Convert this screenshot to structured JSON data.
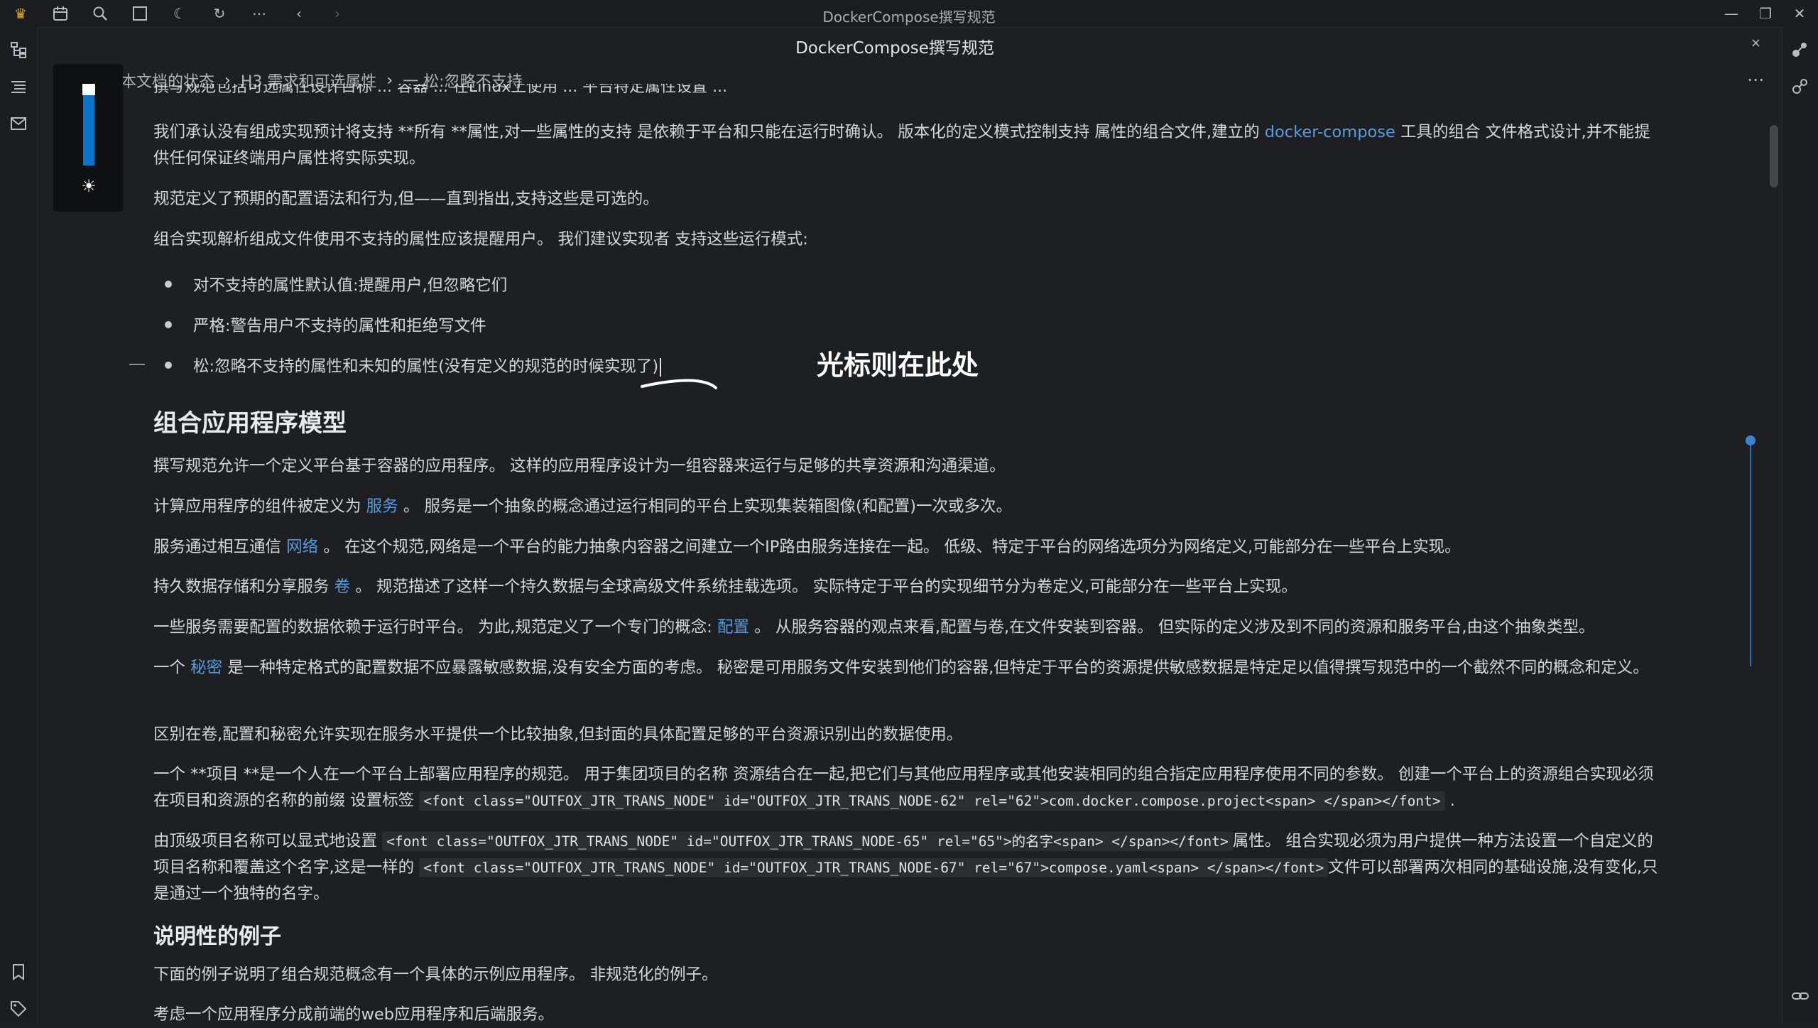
{
  "app": {
    "window_title": "DockerCompose撰写规范",
    "doc_title": "DockerCompose撰写规范"
  },
  "titlebar_icons": [
    "crown-icon",
    "calendar-icon",
    "search-icon",
    "square-icon",
    "moon-icon",
    "refresh-icon",
    "more-icon",
    "back-icon",
    "forward-icon"
  ],
  "breadcrumb": {
    "item1": "本文档的状态",
    "item2": "H3 需求和可选属性",
    "item3": "一 松:忽略不支持",
    "sep": "›"
  },
  "content": {
    "cut_line": "撰写规范包括可选属性设计目标 ... 容器 ... 在Linux上使用 ... 平台特定属性设置 ...",
    "p1a": "我们承认没有组成实现预计将支持 **所有 **属性,对一些属性的支持 是依赖于平台和只能在运行时确认。 版本化的定义模式控制支持 属性的组合文件,建立的 ",
    "p1_link": "docker-compose",
    "p1b": " 工具的组合 文件格式设计,并不能提供任何保证终端用户属性将实际实现。",
    "p2": "规范定义了预期的配置语法和行为,但——直到指出,支持这些是可选的。",
    "p3": "组合实现解析组成文件使用不支持的属性应该提醒用户。 我们建议实现者 支持这些运行模式:",
    "list": [
      "对不支持的属性默认值:提醒用户,但忽略它们",
      "严格:警告用户不支持的属性和拒绝写文件",
      "松:忽略不支持的属性和未知的属性(没有定义的规范的时候实现了)"
    ],
    "annotation": "光标则在此处",
    "h2": "组合应用程序模型",
    "p4": "撰写规范允许一个定义平台基于容器的应用程序。 这样的应用程序设计为一组容器来运行与足够的共享资源和沟通渠道。",
    "p5a": "计算应用程序的组件被定义为 ",
    "p5_link": "服务",
    "p5b": " 。 服务是一个抽象的概念通过运行相同的平台上实现集装箱图像(和配置)一次或多次。",
    "p6a": "服务通过相互通信 ",
    "p6_link": "网络",
    "p6b": " 。 在这个规范,网络是一个平台的能力抽象内容器之间建立一个IP路由服务连接在一起。 低级、特定于平台的网络选项分为网络定义,可能部分在一些平台上实现。",
    "p7a": "持久数据存储和分享服务 ",
    "p7_link": "卷",
    "p7b": " 。 规范描述了这样一个持久数据与全球高级文件系统挂载选项。 实际特定于平台的实现细节分为卷定义,可能部分在一些平台上实现。",
    "p8a": "一些服务需要配置的数据依赖于运行时平台。 为此,规范定义了一个专门的概念: ",
    "p8_link": "配置",
    "p8b": " 。 从服务容器的观点来看,配置与卷,在文件安装到容器。 但实际的定义涉及到不同的资源和服务平台,由这个抽象类型。",
    "p9a": "一个 ",
    "p9_link": "秘密",
    "p9b": " 是一种特定格式的配置数据不应暴露敏感数据,没有安全方面的考虑。 秘密是可用服务文件安装到他们的容器,但特定于平台的资源提供敏感数据是特定足以值得撰写规范中的一个截然不同的概念和定义。",
    "p10": "区别在卷,配置和秘密允许实现在服务水平提供一个比较抽象,但封面的具体配置足够的平台资源识别出的数据使用。",
    "p11a": "一个 **项目 **是一个人在一个平台上部署应用程序的规范。 用于集团项目的名称 资源结合在一起,把它们与其他应用程序或其他安装相同的组合指定应用程序使用不同的参数。 创建一个平台上的资源组合实现必须在项目和资源的名称的前缀 设置标签 ",
    "p11_code": "<font class=\"OUTFOX_JTR_TRANS_NODE\" id=\"OUTFOX_JTR_TRANS_NODE-62\" rel=\"62\">com.docker.compose.project<span> </span></font>",
    "p11b": " .",
    "p12a": "由顶级项目名称可以显式地设置 ",
    "p12_code1": "<font class=\"OUTFOX_JTR_TRANS_NODE\" id=\"OUTFOX_JTR_TRANS_NODE-65\" rel=\"65\">的名字<span> </span></font>",
    "p12b": "属性。 组合实现必须为用户提供一种方法设置一个自定义的项目名称和覆盖这个名字,这是一样的 ",
    "p12_code2": "<font class=\"OUTFOX_JTR_TRANS_NODE\" id=\"OUTFOX_JTR_TRANS_NODE-67\" rel=\"67\">compose.yaml<span> </span></font>",
    "p12c": "文件可以部署两次相同的基础设施,没有变化,只是通过一个独特的名字。",
    "h3": "说明性的例子",
    "p13": "下面的例子说明了组合规范概念有一个具体的示例应用程序。 非规范化的例子。",
    "p14": "考虑一个应用程序分成前端的web应用程序和后端服务。"
  },
  "colors": {
    "background": "#1e1f22",
    "link": "#5a9bdc",
    "accent": "#0b73c9"
  }
}
